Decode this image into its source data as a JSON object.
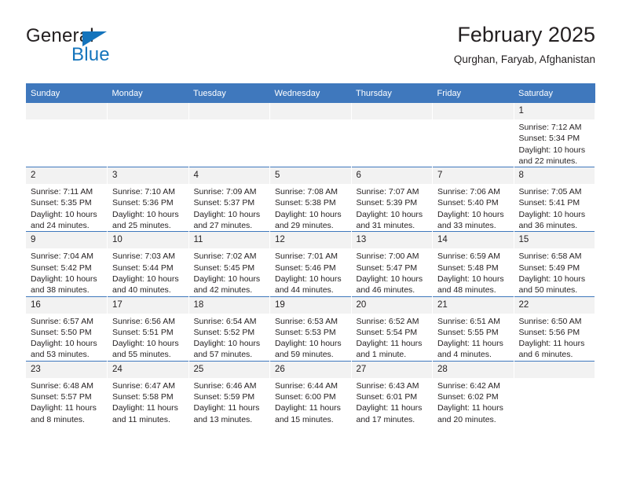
{
  "brand": {
    "word1": "General",
    "word2": "Blue",
    "accent_color": "#1474bc",
    "triangle_icon": "brand-triangle-icon"
  },
  "header": {
    "title": "February 2025",
    "location": "Qurghan, Faryab, Afghanistan"
  },
  "calendar": {
    "header_bg": "#3f78bd",
    "daynum_bg": "#f2f2f2",
    "weekdays": [
      "Sunday",
      "Monday",
      "Tuesday",
      "Wednesday",
      "Thursday",
      "Friday",
      "Saturday"
    ],
    "weeks": [
      [
        {
          "day": "",
          "empty": true
        },
        {
          "day": "",
          "empty": true
        },
        {
          "day": "",
          "empty": true
        },
        {
          "day": "",
          "empty": true
        },
        {
          "day": "",
          "empty": true
        },
        {
          "day": "",
          "empty": true
        },
        {
          "day": "1",
          "sunrise": "Sunrise: 7:12 AM",
          "sunset": "Sunset: 5:34 PM",
          "daylight": "Daylight: 10 hours and 22 minutes."
        }
      ],
      [
        {
          "day": "2",
          "sunrise": "Sunrise: 7:11 AM",
          "sunset": "Sunset: 5:35 PM",
          "daylight": "Daylight: 10 hours and 24 minutes."
        },
        {
          "day": "3",
          "sunrise": "Sunrise: 7:10 AM",
          "sunset": "Sunset: 5:36 PM",
          "daylight": "Daylight: 10 hours and 25 minutes."
        },
        {
          "day": "4",
          "sunrise": "Sunrise: 7:09 AM",
          "sunset": "Sunset: 5:37 PM",
          "daylight": "Daylight: 10 hours and 27 minutes."
        },
        {
          "day": "5",
          "sunrise": "Sunrise: 7:08 AM",
          "sunset": "Sunset: 5:38 PM",
          "daylight": "Daylight: 10 hours and 29 minutes."
        },
        {
          "day": "6",
          "sunrise": "Sunrise: 7:07 AM",
          "sunset": "Sunset: 5:39 PM",
          "daylight": "Daylight: 10 hours and 31 minutes."
        },
        {
          "day": "7",
          "sunrise": "Sunrise: 7:06 AM",
          "sunset": "Sunset: 5:40 PM",
          "daylight": "Daylight: 10 hours and 33 minutes."
        },
        {
          "day": "8",
          "sunrise": "Sunrise: 7:05 AM",
          "sunset": "Sunset: 5:41 PM",
          "daylight": "Daylight: 10 hours and 36 minutes."
        }
      ],
      [
        {
          "day": "9",
          "sunrise": "Sunrise: 7:04 AM",
          "sunset": "Sunset: 5:42 PM",
          "daylight": "Daylight: 10 hours and 38 minutes."
        },
        {
          "day": "10",
          "sunrise": "Sunrise: 7:03 AM",
          "sunset": "Sunset: 5:44 PM",
          "daylight": "Daylight: 10 hours and 40 minutes."
        },
        {
          "day": "11",
          "sunrise": "Sunrise: 7:02 AM",
          "sunset": "Sunset: 5:45 PM",
          "daylight": "Daylight: 10 hours and 42 minutes."
        },
        {
          "day": "12",
          "sunrise": "Sunrise: 7:01 AM",
          "sunset": "Sunset: 5:46 PM",
          "daylight": "Daylight: 10 hours and 44 minutes."
        },
        {
          "day": "13",
          "sunrise": "Sunrise: 7:00 AM",
          "sunset": "Sunset: 5:47 PM",
          "daylight": "Daylight: 10 hours and 46 minutes."
        },
        {
          "day": "14",
          "sunrise": "Sunrise: 6:59 AM",
          "sunset": "Sunset: 5:48 PM",
          "daylight": "Daylight: 10 hours and 48 minutes."
        },
        {
          "day": "15",
          "sunrise": "Sunrise: 6:58 AM",
          "sunset": "Sunset: 5:49 PM",
          "daylight": "Daylight: 10 hours and 50 minutes."
        }
      ],
      [
        {
          "day": "16",
          "sunrise": "Sunrise: 6:57 AM",
          "sunset": "Sunset: 5:50 PM",
          "daylight": "Daylight: 10 hours and 53 minutes."
        },
        {
          "day": "17",
          "sunrise": "Sunrise: 6:56 AM",
          "sunset": "Sunset: 5:51 PM",
          "daylight": "Daylight: 10 hours and 55 minutes."
        },
        {
          "day": "18",
          "sunrise": "Sunrise: 6:54 AM",
          "sunset": "Sunset: 5:52 PM",
          "daylight": "Daylight: 10 hours and 57 minutes."
        },
        {
          "day": "19",
          "sunrise": "Sunrise: 6:53 AM",
          "sunset": "Sunset: 5:53 PM",
          "daylight": "Daylight: 10 hours and 59 minutes."
        },
        {
          "day": "20",
          "sunrise": "Sunrise: 6:52 AM",
          "sunset": "Sunset: 5:54 PM",
          "daylight": "Daylight: 11 hours and 1 minute."
        },
        {
          "day": "21",
          "sunrise": "Sunrise: 6:51 AM",
          "sunset": "Sunset: 5:55 PM",
          "daylight": "Daylight: 11 hours and 4 minutes."
        },
        {
          "day": "22",
          "sunrise": "Sunrise: 6:50 AM",
          "sunset": "Sunset: 5:56 PM",
          "daylight": "Daylight: 11 hours and 6 minutes."
        }
      ],
      [
        {
          "day": "23",
          "sunrise": "Sunrise: 6:48 AM",
          "sunset": "Sunset: 5:57 PM",
          "daylight": "Daylight: 11 hours and 8 minutes."
        },
        {
          "day": "24",
          "sunrise": "Sunrise: 6:47 AM",
          "sunset": "Sunset: 5:58 PM",
          "daylight": "Daylight: 11 hours and 11 minutes."
        },
        {
          "day": "25",
          "sunrise": "Sunrise: 6:46 AM",
          "sunset": "Sunset: 5:59 PM",
          "daylight": "Daylight: 11 hours and 13 minutes."
        },
        {
          "day": "26",
          "sunrise": "Sunrise: 6:44 AM",
          "sunset": "Sunset: 6:00 PM",
          "daylight": "Daylight: 11 hours and 15 minutes."
        },
        {
          "day": "27",
          "sunrise": "Sunrise: 6:43 AM",
          "sunset": "Sunset: 6:01 PM",
          "daylight": "Daylight: 11 hours and 17 minutes."
        },
        {
          "day": "28",
          "sunrise": "Sunrise: 6:42 AM",
          "sunset": "Sunset: 6:02 PM",
          "daylight": "Daylight: 11 hours and 20 minutes."
        },
        {
          "day": "",
          "empty": true
        }
      ]
    ]
  }
}
